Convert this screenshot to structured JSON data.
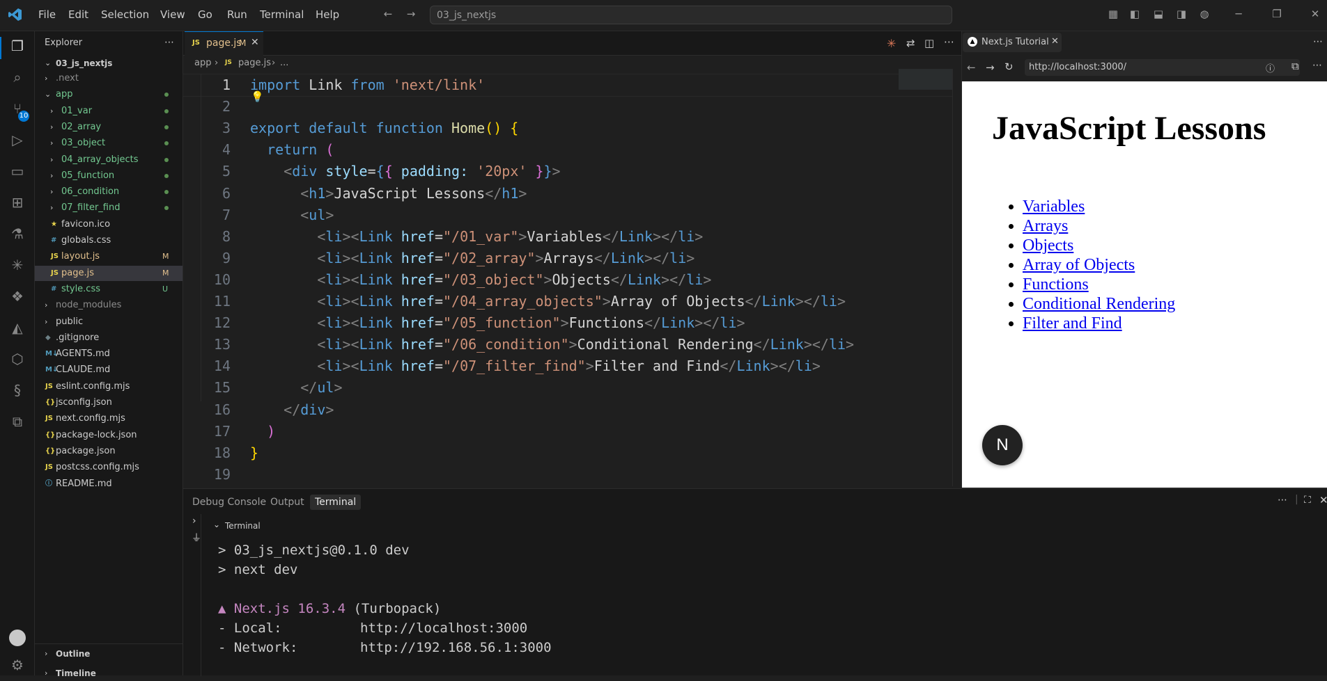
{
  "menu": {
    "file": "File",
    "edit": "Edit",
    "selection": "Selection",
    "view": "View",
    "go": "Go",
    "run": "Run",
    "terminal": "Terminal",
    "help": "Help"
  },
  "command_center": {
    "text": "03_js_nextjs"
  },
  "activity": {
    "scm_badge": "10"
  },
  "explorer": {
    "title": "Explorer",
    "root": "03_js_nextjs",
    "items": [
      {
        "label": ".next",
        "color": "#8c8c8c"
      },
      {
        "label": "app",
        "color": "#73c991"
      },
      {
        "label": "01_var",
        "color": "#73c991"
      },
      {
        "label": "02_array",
        "color": "#73c991"
      },
      {
        "label": "03_object",
        "color": "#73c991"
      },
      {
        "label": "04_array_objects",
        "color": "#73c991"
      },
      {
        "label": "05_function",
        "color": "#73c991"
      },
      {
        "label": "06_condition",
        "color": "#73c991"
      },
      {
        "label": "07_filter_find",
        "color": "#73c991"
      },
      {
        "label": "favicon.ico",
        "color": "#cccccc"
      },
      {
        "label": "globals.css",
        "color": "#cccccc"
      },
      {
        "label": "layout.js",
        "color": "#e2c08d",
        "badge": "M"
      },
      {
        "label": "page.js",
        "color": "#e2c08d",
        "badge": "M"
      },
      {
        "label": "style.css",
        "color": "#73c991",
        "badge": "U"
      },
      {
        "label": "node_modules",
        "color": "#8c8c8c"
      },
      {
        "label": "public",
        "color": "#cccccc"
      },
      {
        "label": ".gitignore",
        "color": "#cccccc"
      },
      {
        "label": "AGENTS.md",
        "color": "#cccccc"
      },
      {
        "label": "CLAUDE.md",
        "color": "#cccccc"
      },
      {
        "label": "eslint.config.mjs",
        "color": "#cccccc"
      },
      {
        "label": "jsconfig.json",
        "color": "#cccccc"
      },
      {
        "label": "next.config.mjs",
        "color": "#cccccc"
      },
      {
        "label": "package-lock.json",
        "color": "#cccccc"
      },
      {
        "label": "package.json",
        "color": "#cccccc"
      },
      {
        "label": "postcss.config.mjs",
        "color": "#cccccc"
      },
      {
        "label": "README.md",
        "color": "#cccccc"
      }
    ],
    "outline": "Outline",
    "timeline": "Timeline"
  },
  "editor": {
    "tab_label": "page.js",
    "tab_badge": "M",
    "crumb_app": "app",
    "crumb_file": "page.js",
    "crumb_more": "...",
    "line_numbers": [
      "1",
      "2",
      "3",
      "4",
      "5",
      "6",
      "7",
      "8",
      "9",
      "10",
      "11",
      "12",
      "13",
      "14",
      "15",
      "16",
      "17",
      "18",
      "19"
    ],
    "code": {
      "l1_import": "import",
      "l1_link": " Link ",
      "l1_from": "from",
      "l1_str": " 'next/link'",
      "l3_export": "export",
      "l3_default": " default",
      "l3_function": " function",
      "l3_home": " Home",
      "l3_paren": "()",
      "l3_brace": " {",
      "l4_return": "return",
      "l4_paren": " (",
      "l5_open": "<",
      "l5_div": "div",
      "l5_style": " style",
      "l5_eq": "=",
      "l5_b1": "{",
      "l5_b2": "{",
      "l5_prop": " padding: ",
      "l5_val": "'20px'",
      "l5_b3": " }",
      "l5_b4": "}",
      "l5_close": ">",
      "l6_open": "<",
      "l6_h1": "h1",
      "l6_gt": ">",
      "l6_text": "JavaScript Lessons",
      "l6_end": "</",
      "l6_h1b": "h1",
      "l6_gt2": ">",
      "l7_open": "<",
      "l7_ul": "ul",
      "l7_gt": ">",
      "links": [
        {
          "href": "\"/01_var\"",
          "text": "Variables"
        },
        {
          "href": "\"/02_array\"",
          "text": "Arrays"
        },
        {
          "href": "\"/03_object\"",
          "text": "Objects"
        },
        {
          "href": "\"/04_array_objects\"",
          "text": "Array of Objects"
        },
        {
          "href": "\"/05_function\"",
          "text": "Functions"
        },
        {
          "href": "\"/06_condition\"",
          "text": "Conditional Rendering"
        },
        {
          "href": "\"/07_filter_find\"",
          "text": "Filter and Find"
        }
      ],
      "li": "li",
      "link": "Link",
      "href_attr": " href",
      "eq": "=",
      "l15_end": "</",
      "l15_ul": "ul",
      "l15_gt": ">",
      "l16_end": "</",
      "l16_div": "div",
      "l16_gt": ">",
      "l17_paren": ")",
      "l18_brace": "}"
    }
  },
  "browser": {
    "tab_title": "Next.js Tutorial",
    "url": "http://localhost:3000/",
    "heading": "JavaScript Lessons",
    "links": [
      "Variables",
      "Arrays",
      "Objects",
      "Array of Objects",
      "Functions",
      "Conditional Rendering",
      "Filter and Find"
    ],
    "badge_letter": "N"
  },
  "panel": {
    "tabs": {
      "debug": "Debug Console",
      "output": "Output",
      "terminal": "Terminal"
    },
    "terminal_header": "Terminal",
    "lines": {
      "l1": "> 03_js_nextjs@0.1.0 dev",
      "l2": "> next dev",
      "l3_tri": "▲ Next.js 16.3.4",
      "l3_rest": " (Turbopack)",
      "l4_label": "- Local:",
      "l4_value": "http://localhost:3000",
      "l5_label": "- Network:",
      "l5_value": "http://192.168.56.1:3000"
    }
  }
}
